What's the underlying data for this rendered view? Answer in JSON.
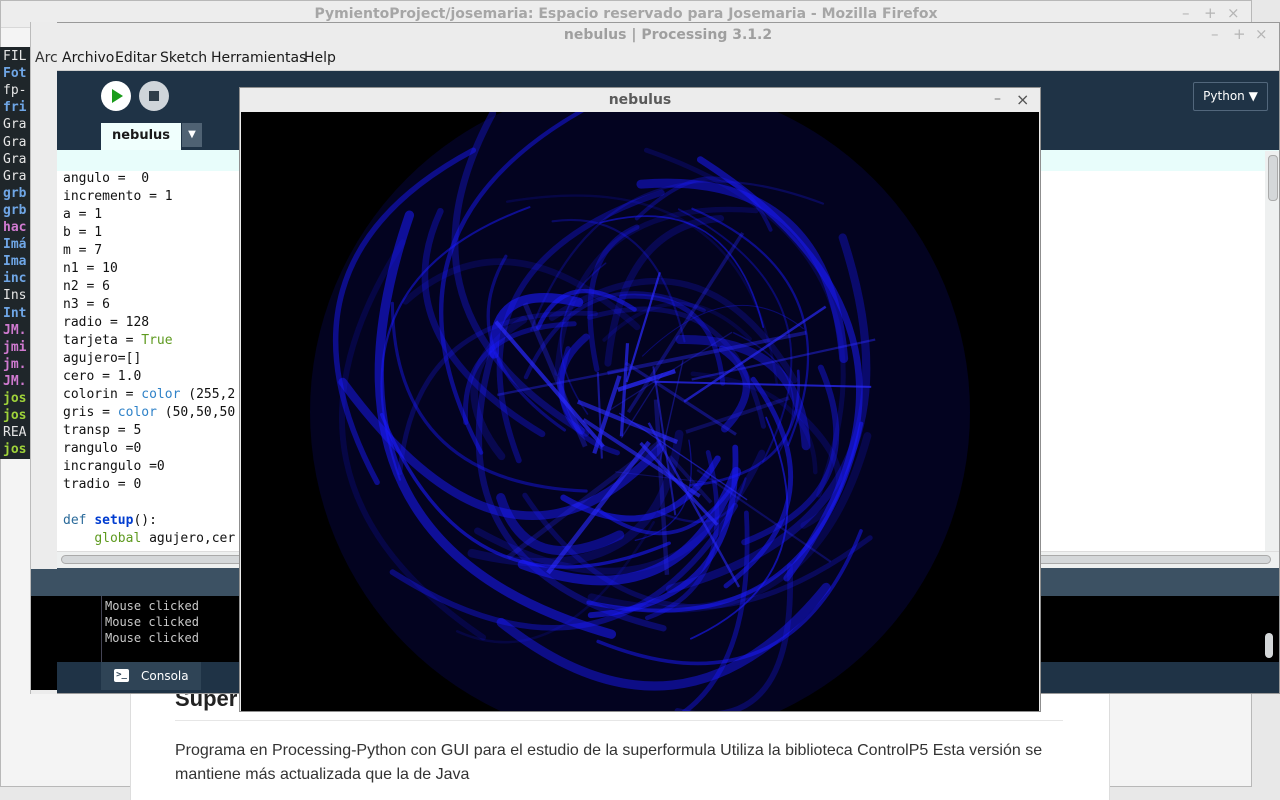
{
  "firefox": {
    "title": "PymientoProject/josemaria: Espacio reservado para Josemaria - Mozilla Firefox",
    "heading": "Super",
    "paragraph": "Programa en Processing-Python con GUI para el estudio de la superformula Utiliza la biblioteca ControlP5 Esta versión se mantiene más actualizada que la de Java"
  },
  "window_controls": {
    "minimize": "–",
    "maximize": "+",
    "close": "×"
  },
  "terminal": {
    "lines": [
      {
        "text": "FIL",
        "color": "#e6e6e6"
      },
      {
        "text": "Fot",
        "color": "#6fa6e6"
      },
      {
        "text": "fp-",
        "color": "#e6e6e6"
      },
      {
        "text": "fri",
        "color": "#6fa6e6"
      },
      {
        "text": "Gra",
        "color": "#e6e6e6"
      },
      {
        "text": "Gra",
        "color": "#e6e6e6"
      },
      {
        "text": "Gra",
        "color": "#e6e6e6"
      },
      {
        "text": "Gra",
        "color": "#e6e6e6"
      },
      {
        "text": "grb",
        "color": "#6fa6e6"
      },
      {
        "text": "grb",
        "color": "#6fa6e6"
      },
      {
        "text": "hac",
        "color": "#d07ad0"
      },
      {
        "text": "Imá",
        "color": "#6fa6e6"
      },
      {
        "text": "Ima",
        "color": "#6fa6e6"
      },
      {
        "text": "inc",
        "color": "#6fa6e6"
      },
      {
        "text": "Ins",
        "color": "#e6e6e6"
      },
      {
        "text": "Int",
        "color": "#6fa6e6"
      },
      {
        "text": "JM.",
        "color": "#d07ad0"
      },
      {
        "text": "jmi",
        "color": "#d07ad0"
      },
      {
        "text": "jm.",
        "color": "#d07ad0"
      },
      {
        "text": "JM.",
        "color": "#d07ad0"
      },
      {
        "text": "jos",
        "color": "#9fd33a"
      },
      {
        "text": "jos",
        "color": "#9fd33a"
      },
      {
        "text": "REA",
        "color": "#e6e6e6"
      },
      {
        "text": "jos",
        "color": "#9fd33a"
      }
    ]
  },
  "processing": {
    "title": "nebulus | Processing 3.1.2",
    "menu": [
      "Archivo",
      "Editar",
      "Sketch",
      "Herramientas",
      "Help"
    ],
    "menu_behind": "Arc",
    "mode": "Python ▼",
    "tab": "nebulus",
    "tab_menu": "▼",
    "code": [
      "angulo =  0",
      "incremento = 1",
      "a = 1",
      "b = 1",
      "m = 7",
      "n1 = 10",
      "n2 = 6",
      "n3 = 6",
      "radio = 128",
      "tarjeta = ",
      "agujero=[]",
      "cero = 1.0",
      "colorin = ",
      "gris = ",
      "transp = 5",
      "rangulo =0",
      "incrangulo =0",
      "tradio = 0",
      "",
      "def ",
      "    "
    ],
    "code_tokens": {
      "true_kw": "True",
      "color_kw": "color",
      "colorin_args": " (255,2",
      "gris_args": " (50,50,50",
      "setup": "setup",
      "setup_tail": "():",
      "global_kw": "global",
      "global_tail": " agujero,cer"
    },
    "console_lines": [
      "Mouse clicked",
      "Mouse clicked",
      "Mouse clicked"
    ],
    "console_tab": "Consola",
    "console_icon": ">_"
  },
  "sketch": {
    "title": "nebulus"
  },
  "colors": {
    "editor_bg": "#ffffff",
    "toolbar_bg": "#1f3346",
    "run_button": "#1a9b1a",
    "nebula_blue": "#1a1aff"
  }
}
